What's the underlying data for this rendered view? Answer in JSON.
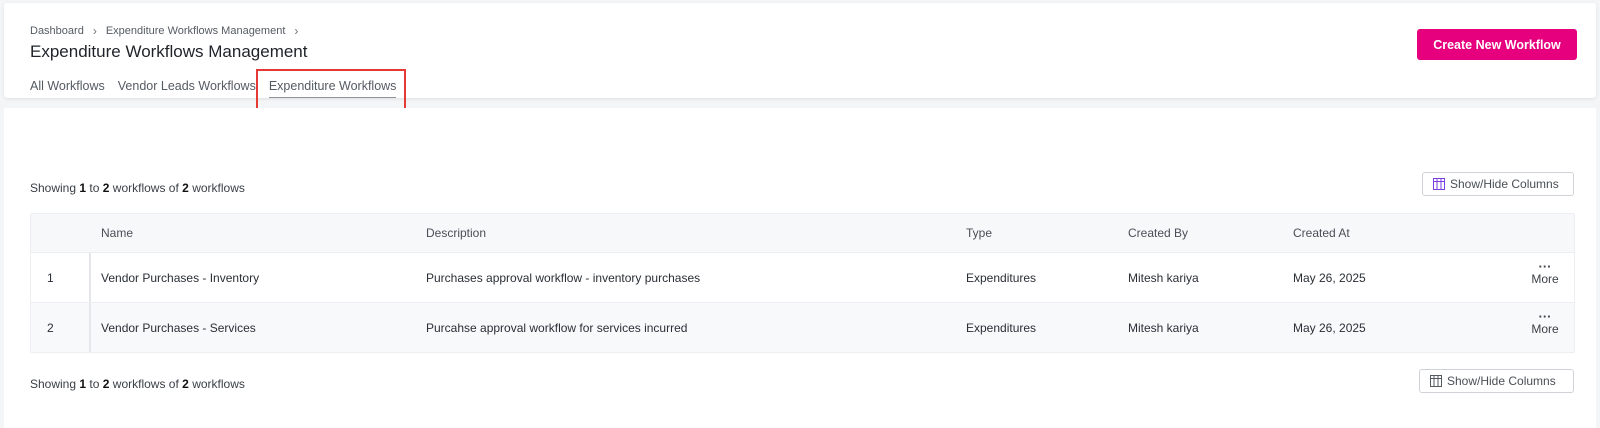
{
  "breadcrumb": {
    "items": [
      "Dashboard",
      "Expenditure Workflows Management"
    ],
    "separator": "›"
  },
  "page": {
    "title": "Expenditure Workflows Management"
  },
  "tabs": [
    {
      "label": "All Workflows",
      "active": false
    },
    {
      "label": "Vendor Leads Workflows",
      "active": false
    },
    {
      "label": "Expenditure Workflows",
      "active": true
    }
  ],
  "actions": {
    "create_label": "Create New Workflow"
  },
  "summary": {
    "prefix": "Showing",
    "from": "1",
    "to_word": "to",
    "to": "2",
    "of_word": "workflows of",
    "total": "2",
    "suffix": "workflows"
  },
  "columns_toggle": {
    "label": "Show/Hide Columns",
    "icon": "grid-columns-icon"
  },
  "table": {
    "headers": [
      "",
      "Name",
      "Description",
      "Type",
      "Created By",
      "Created At",
      ""
    ],
    "rows": [
      {
        "index": "1",
        "name": "Vendor Purchases - Inventory",
        "description": "Purchases approval workflow - inventory purchases",
        "type": "Expenditures",
        "created_by": "Mitesh kariya",
        "created_at": "May 26, 2025",
        "more_label": "More"
      },
      {
        "index": "2",
        "name": "Vendor Purchases - Services",
        "description": "Purcahse approval workflow for services incurred",
        "type": "Expenditures",
        "created_by": "Mitesh kariya",
        "created_at": "May 26, 2025",
        "more_label": "More"
      }
    ]
  },
  "colors": {
    "accent": "#e6007e",
    "highlight": "#e53935"
  }
}
